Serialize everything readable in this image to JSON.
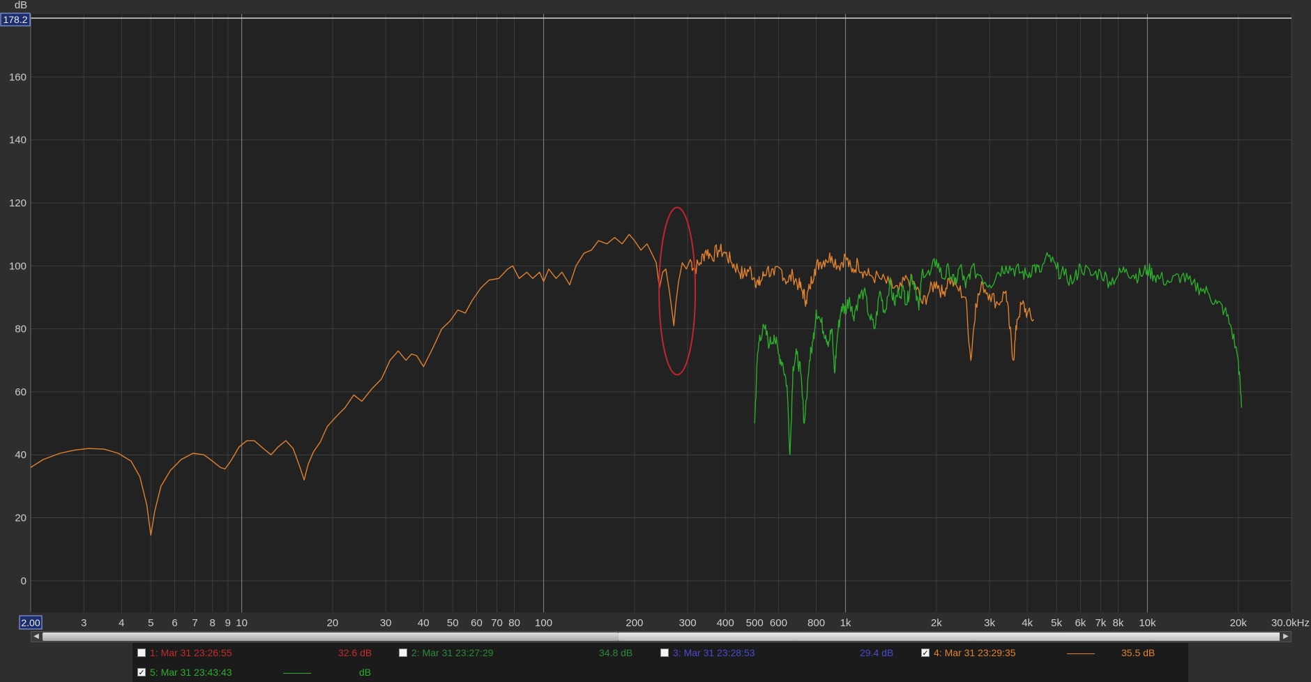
{
  "chart_data": {
    "type": "line",
    "ylabel": "dB",
    "ylim": [
      -10,
      180
    ],
    "y_top_readout": "178.2",
    "x_scale": "log",
    "xlim": [
      2,
      30000
    ],
    "x_start_readout": "2.00",
    "y_ticks": [
      {
        "value": 0,
        "label": "0"
      },
      {
        "value": 20,
        "label": "20"
      },
      {
        "value": 40,
        "label": "40"
      },
      {
        "value": 60,
        "label": "60"
      },
      {
        "value": 80,
        "label": "80"
      },
      {
        "value": 100,
        "label": "100"
      },
      {
        "value": 120,
        "label": "120"
      },
      {
        "value": 140,
        "label": "140"
      },
      {
        "value": 160,
        "label": "160"
      }
    ],
    "x_ticks": [
      {
        "value": 3,
        "label": "3"
      },
      {
        "value": 4,
        "label": "4"
      },
      {
        "value": 5,
        "label": "5"
      },
      {
        "value": 6,
        "label": "6"
      },
      {
        "value": 7,
        "label": "7"
      },
      {
        "value": 8,
        "label": "8"
      },
      {
        "value": 9,
        "label": "9"
      },
      {
        "value": 10,
        "label": "10"
      },
      {
        "value": 20,
        "label": "20"
      },
      {
        "value": 30,
        "label": "30"
      },
      {
        "value": 40,
        "label": "40"
      },
      {
        "value": 50,
        "label": "50"
      },
      {
        "value": 60,
        "label": "60"
      },
      {
        "value": 70,
        "label": "70"
      },
      {
        "value": 80,
        "label": "80"
      },
      {
        "value": 100,
        "label": "100"
      },
      {
        "value": 200,
        "label": "200"
      },
      {
        "value": 300,
        "label": "300"
      },
      {
        "value": 400,
        "label": "400"
      },
      {
        "value": 500,
        "label": "500"
      },
      {
        "value": 600,
        "label": "600"
      },
      {
        "value": 800,
        "label": "800"
      },
      {
        "value": 1000,
        "label": "1k"
      },
      {
        "value": 2000,
        "label": "2k"
      },
      {
        "value": 3000,
        "label": "3k"
      },
      {
        "value": 4000,
        "label": "4k"
      },
      {
        "value": 5000,
        "label": "5k"
      },
      {
        "value": 6000,
        "label": "6k"
      },
      {
        "value": 7000,
        "label": "7k"
      },
      {
        "value": 8000,
        "label": "8k"
      },
      {
        "value": 10000,
        "label": "10k"
      },
      {
        "value": 20000,
        "label": "20k"
      },
      {
        "value": 30000,
        "label": "30.0kHz"
      }
    ],
    "grid": true,
    "series": [
      {
        "name": "4: Mar 31 23:29:35",
        "color": "#e0822e",
        "points": [
          [
            2,
            36
          ],
          [
            2.2,
            38.5
          ],
          [
            2.5,
            40.5
          ],
          [
            2.8,
            41.5
          ],
          [
            3.1,
            42
          ],
          [
            3.5,
            41.8
          ],
          [
            3.9,
            40.5
          ],
          [
            4.3,
            38
          ],
          [
            4.6,
            33
          ],
          [
            4.85,
            24
          ],
          [
            5,
            14.5
          ],
          [
            5.15,
            22
          ],
          [
            5.4,
            30
          ],
          [
            5.8,
            35
          ],
          [
            6.3,
            38.5
          ],
          [
            6.9,
            40.5
          ],
          [
            7.5,
            40
          ],
          [
            8,
            38
          ],
          [
            8.5,
            36
          ],
          [
            8.8,
            35.5
          ],
          [
            9.2,
            38
          ],
          [
            9.8,
            42.5
          ],
          [
            10.4,
            44.5
          ],
          [
            11,
            44.5
          ],
          [
            11.8,
            42
          ],
          [
            12.5,
            40
          ],
          [
            13.2,
            42.5
          ],
          [
            14,
            44.5
          ],
          [
            14.8,
            42
          ],
          [
            15.6,
            36
          ],
          [
            16.1,
            32
          ],
          [
            16.6,
            37
          ],
          [
            17.3,
            41
          ],
          [
            18.2,
            44
          ],
          [
            19.2,
            49
          ],
          [
            20.5,
            52
          ],
          [
            22,
            55
          ],
          [
            23.5,
            59
          ],
          [
            25,
            57
          ],
          [
            27,
            61
          ],
          [
            29,
            64
          ],
          [
            31,
            70
          ],
          [
            33,
            73
          ],
          [
            35,
            70
          ],
          [
            36.5,
            72
          ],
          [
            38,
            71.5
          ],
          [
            40,
            68
          ],
          [
            43,
            74
          ],
          [
            46,
            80
          ],
          [
            49,
            82.5
          ],
          [
            52,
            86
          ],
          [
            55,
            85
          ],
          [
            58,
            89
          ],
          [
            62,
            93
          ],
          [
            66,
            95.5
          ],
          [
            71,
            96
          ],
          [
            76,
            99
          ],
          [
            79,
            100
          ],
          [
            83,
            96
          ],
          [
            88,
            98
          ],
          [
            92,
            96
          ],
          [
            97,
            98
          ],
          [
            100,
            95
          ],
          [
            104,
            99
          ],
          [
            110,
            96
          ],
          [
            115,
            98
          ],
          [
            122,
            94
          ],
          [
            128,
            100
          ],
          [
            136,
            104
          ],
          [
            144,
            105
          ],
          [
            152,
            108
          ],
          [
            162,
            107
          ],
          [
            172,
            109
          ],
          [
            182,
            107
          ],
          [
            192,
            110
          ],
          [
            200,
            108
          ],
          [
            210,
            105
          ],
          [
            220,
            107
          ],
          [
            228,
            104
          ],
          [
            236,
            101
          ],
          [
            242,
            93
          ],
          [
            248,
            98
          ],
          [
            254,
            99
          ],
          [
            260,
            93
          ],
          [
            266,
            86
          ],
          [
            270,
            81
          ],
          [
            274,
            88
          ],
          [
            280,
            95
          ],
          [
            288,
            101
          ],
          [
            297,
            99
          ],
          [
            306,
            102
          ],
          [
            315,
            99
          ],
          [
            330,
            101
          ],
          [
            345,
            105
          ],
          [
            360,
            103
          ],
          [
            380,
            105
          ],
          [
            400,
            104
          ],
          [
            420,
            101
          ],
          [
            440,
            99
          ],
          [
            460,
            97
          ],
          [
            480,
            99
          ],
          [
            500,
            96
          ],
          [
            515,
            94
          ],
          [
            530,
            96
          ],
          [
            550,
            99
          ],
          [
            580,
            97
          ],
          [
            610,
            99
          ],
          [
            640,
            95
          ],
          [
            670,
            97
          ],
          [
            700,
            94
          ],
          [
            720,
            92
          ],
          [
            740,
            89
          ],
          [
            760,
            93
          ],
          [
            790,
            99
          ],
          [
            820,
            101
          ],
          [
            860,
            102
          ],
          [
            900,
            103
          ],
          [
            950,
            100
          ],
          [
            1000,
            103
          ],
          [
            1050,
            98
          ],
          [
            1100,
            101
          ],
          [
            1150,
            98
          ],
          [
            1200,
            97
          ],
          [
            1300,
            96
          ],
          [
            1400,
            94
          ],
          [
            1500,
            92
          ],
          [
            1600,
            96
          ],
          [
            1700,
            94
          ],
          [
            1800,
            88
          ],
          [
            1900,
            92
          ],
          [
            2000,
            95
          ],
          [
            2100,
            91
          ],
          [
            2200,
            96
          ],
          [
            2350,
            93
          ],
          [
            2500,
            90
          ],
          [
            2600,
            70
          ],
          [
            2700,
            88
          ],
          [
            2850,
            94
          ],
          [
            3000,
            91
          ],
          [
            3200,
            88
          ],
          [
            3400,
            92
          ],
          [
            3500,
            80
          ],
          [
            3600,
            70
          ],
          [
            3700,
            83
          ],
          [
            3850,
            88
          ],
          [
            4000,
            85
          ],
          [
            4200,
            83
          ]
        ]
      },
      {
        "name": "5: Mar 31 23:43:43",
        "color": "#2bae2b",
        "points": [
          [
            500,
            50
          ],
          [
            510,
            70
          ],
          [
            520,
            78
          ],
          [
            540,
            80
          ],
          [
            560,
            75
          ],
          [
            580,
            78
          ],
          [
            600,
            72
          ],
          [
            620,
            69
          ],
          [
            640,
            62
          ],
          [
            655,
            40
          ],
          [
            670,
            68
          ],
          [
            690,
            72
          ],
          [
            710,
            66
          ],
          [
            730,
            50
          ],
          [
            760,
            70
          ],
          [
            780,
            76
          ],
          [
            800,
            86
          ],
          [
            830,
            82
          ],
          [
            860,
            78
          ],
          [
            880,
            76
          ],
          [
            900,
            80
          ],
          [
            920,
            66
          ],
          [
            940,
            78
          ],
          [
            970,
            87
          ],
          [
            1000,
            86
          ],
          [
            1030,
            90
          ],
          [
            1060,
            84
          ],
          [
            1100,
            89
          ],
          [
            1150,
            92
          ],
          [
            1200,
            84
          ],
          [
            1250,
            80
          ],
          [
            1300,
            92
          ],
          [
            1350,
            85
          ],
          [
            1400,
            95
          ],
          [
            1450,
            88
          ],
          [
            1500,
            92
          ],
          [
            1560,
            92
          ],
          [
            1600,
            88
          ],
          [
            1650,
            97
          ],
          [
            1700,
            94
          ],
          [
            1750,
            86
          ],
          [
            1800,
            99
          ],
          [
            1900,
            97
          ],
          [
            2000,
            102
          ],
          [
            2100,
            96
          ],
          [
            2200,
            99
          ],
          [
            2300,
            94
          ],
          [
            2400,
            100
          ],
          [
            2500,
            93
          ],
          [
            2600,
            99
          ],
          [
            2800,
            97
          ],
          [
            3000,
            94
          ],
          [
            3200,
            98
          ],
          [
            3400,
            100
          ],
          [
            3600,
            99
          ],
          [
            3800,
            98
          ],
          [
            4000,
            97
          ],
          [
            4200,
            100
          ],
          [
            4400,
            98
          ],
          [
            4700,
            103
          ],
          [
            5000,
            99
          ],
          [
            5300,
            97
          ],
          [
            5700,
            95
          ],
          [
            6000,
            100
          ],
          [
            6500,
            97
          ],
          [
            7000,
            98
          ],
          [
            7500,
            95
          ],
          [
            8000,
            97
          ],
          [
            8500,
            99
          ],
          [
            9000,
            97
          ],
          [
            9500,
            97
          ],
          [
            10000,
            99
          ],
          [
            10500,
            97
          ],
          [
            11000,
            96
          ],
          [
            12000,
            95
          ],
          [
            13000,
            97
          ],
          [
            14000,
            94
          ],
          [
            15000,
            93
          ],
          [
            16000,
            91
          ],
          [
            17000,
            88
          ],
          [
            18000,
            86
          ],
          [
            19000,
            80
          ],
          [
            20000,
            70
          ],
          [
            20500,
            55
          ]
        ]
      }
    ]
  },
  "annotation": {
    "label": "red-ellipse",
    "center_freq": 277,
    "center_db": 92,
    "color": "#c22530"
  },
  "scrollbar": {
    "left_arrow": "◀",
    "right_arrow": "▶"
  },
  "legend": [
    {
      "index": 1,
      "label": "1: Mar 31 23:26:55",
      "checked": false,
      "value": "32.6 dB",
      "color": "#c72a2a"
    },
    {
      "index": 2,
      "label": "2: Mar 31 23:27:29",
      "checked": false,
      "value": "34.8 dB",
      "color": "#2c8a36"
    },
    {
      "index": 3,
      "label": "3: Mar 31 23:28:53",
      "checked": false,
      "value": "29.4 dB",
      "color": "#4a4ad2"
    },
    {
      "index": 4,
      "label": "4: Mar 31 23:29:35",
      "checked": true,
      "value": "35.5 dB",
      "color": "#e0822e"
    },
    {
      "index": 5,
      "label": "5: Mar 31 23:43:43",
      "checked": true,
      "value": "dB",
      "color": "#2bae2b"
    }
  ]
}
